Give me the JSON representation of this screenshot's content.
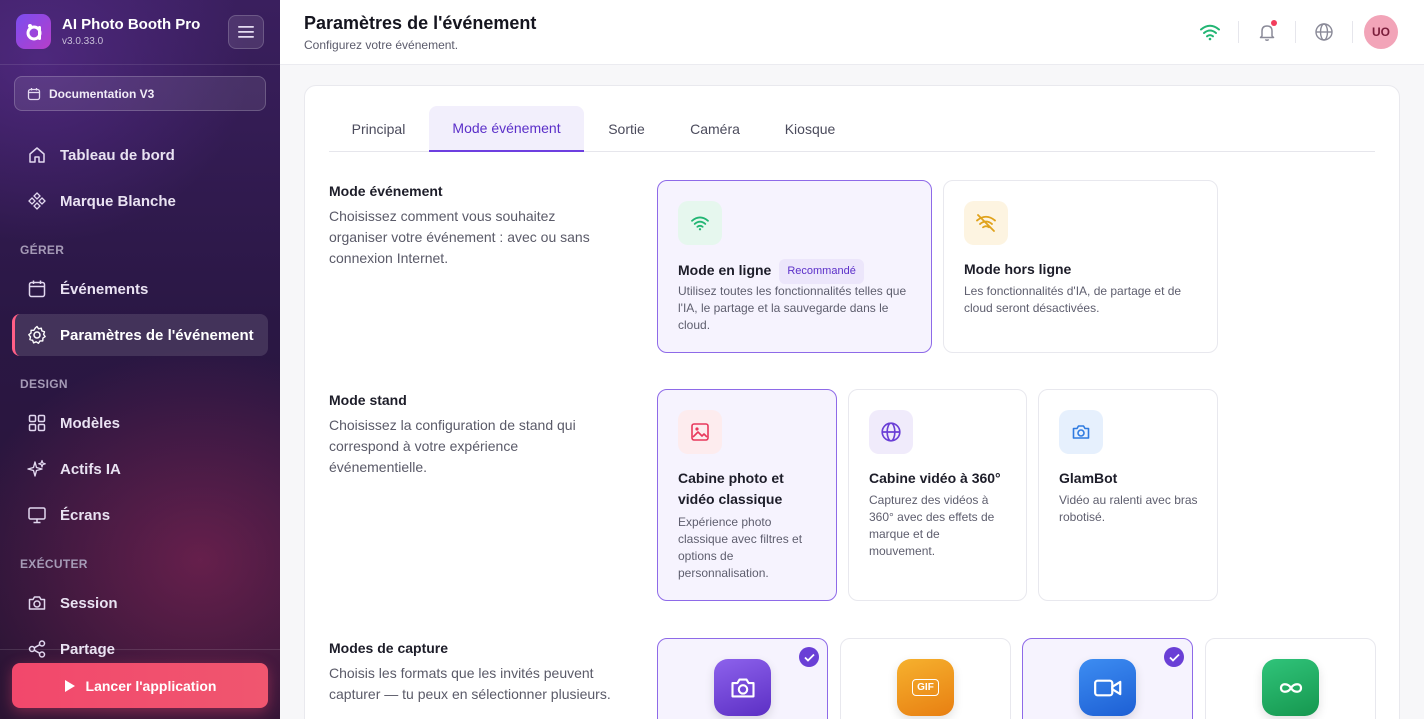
{
  "app": {
    "name": "AI Photo Booth Pro",
    "version": "v3.0.33.0"
  },
  "sidebar": {
    "event_selector": "Documentation V3",
    "top_items": [
      {
        "label": "Tableau de bord",
        "icon": "home-icon"
      },
      {
        "label": "Marque Blanche",
        "icon": "diamond-icon"
      }
    ],
    "sections": [
      {
        "label": "GÉRER",
        "items": [
          {
            "label": "Événements",
            "icon": "calendar-icon"
          },
          {
            "label": "Paramètres de l'événement",
            "icon": "gear-icon",
            "active": true
          }
        ]
      },
      {
        "label": "DESIGN",
        "items": [
          {
            "label": "Modèles",
            "icon": "grid-icon"
          },
          {
            "label": "Actifs IA",
            "icon": "sparkles-icon"
          },
          {
            "label": "Écrans",
            "icon": "monitor-icon"
          }
        ]
      },
      {
        "label": "EXÉCUTER",
        "items": [
          {
            "label": "Session",
            "icon": "camera-icon"
          },
          {
            "label": "Partage",
            "icon": "share-icon"
          }
        ]
      }
    ],
    "launch_button": "Lancer l'application"
  },
  "header": {
    "title": "Paramètres de l'événement",
    "subtitle": "Configurez votre événement.",
    "avatar_initials": "UO"
  },
  "tabs": [
    {
      "label": "Principal"
    },
    {
      "label": "Mode événement",
      "active": true
    },
    {
      "label": "Sortie"
    },
    {
      "label": "Caméra"
    },
    {
      "label": "Kiosque"
    }
  ],
  "event_mode": {
    "title": "Mode événement",
    "description": "Choisissez comment vous souhaitez organiser votre événement : avec ou sans connexion Internet.",
    "options": [
      {
        "title": "Mode en ligne",
        "badge": "Recommandé",
        "description": "Utilisez toutes les fonctionnalités telles que l'IA, le partage et la sauvegarde dans le cloud.",
        "selected": true,
        "icon": "wifi-icon"
      },
      {
        "title": "Mode hors ligne",
        "description": "Les fonctionnalités d'IA, de partage et de cloud seront désactivées.",
        "selected": false,
        "icon": "wifi-off-icon"
      }
    ]
  },
  "stand_mode": {
    "title": "Mode stand",
    "description": "Choisissez la configuration de stand qui correspond à votre expérience événementielle.",
    "options": [
      {
        "title": "Cabine photo et vidéo classique",
        "description": "Expérience photo classique avec filtres et options de personnalisation.",
        "selected": true,
        "icon": "image-icon"
      },
      {
        "title": "Cabine vidéo à 360°",
        "description": "Capturez des vidéos à 360° avec des effets de marque et de mouvement.",
        "selected": false,
        "icon": "globe-icon"
      },
      {
        "title": "GlamBot",
        "description": "Vidéo au ralenti avec bras robotisé.",
        "selected": false,
        "icon": "camera-icon"
      }
    ]
  },
  "capture_modes": {
    "title": "Modes de capture",
    "description": "Choisis les formats que les invités peuvent capturer — tu peux en sélectionner plusieurs.",
    "options": [
      {
        "icon": "photo-camera-icon",
        "selected": true,
        "icon_text": ""
      },
      {
        "icon": "gif-icon",
        "selected": false,
        "icon_text": "GIF"
      },
      {
        "icon": "video-camera-icon",
        "selected": true,
        "icon_text": ""
      },
      {
        "icon": "infinity-icon",
        "selected": false,
        "icon_text": ""
      }
    ]
  },
  "colors": {
    "accent": "#6d3fe0",
    "launch": "#f2486c",
    "online": "#22b573",
    "offline": "#e0a21b"
  }
}
